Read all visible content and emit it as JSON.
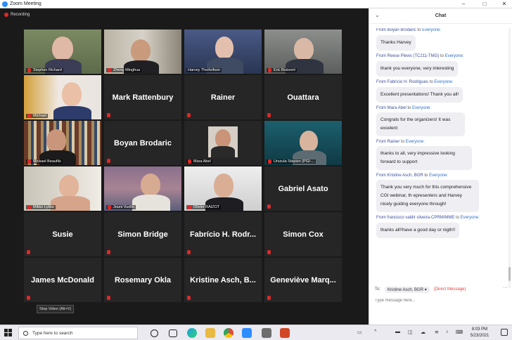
{
  "window": {
    "title": "Zoom Meeting",
    "minimize_glyph": "–",
    "maximize_glyph": "□",
    "close_glyph": "✕"
  },
  "meeting": {
    "recording_label": "Recording",
    "tooltip": "Stop Video (Alt+V)"
  },
  "participants": [
    {
      "name": "Stephen Richard",
      "video": true
    },
    {
      "name": "Zheng Minghua",
      "video": true
    },
    {
      "name": "Harvey Thorleifson",
      "video": true,
      "active": true
    },
    {
      "name": "Eric Boisvert",
      "video": true
    },
    {
      "name": "Michael",
      "video": true
    },
    {
      "name": "Mark Rattenbury",
      "video": false
    },
    {
      "name": "Rainer",
      "video": false
    },
    {
      "name": "Ouattara",
      "video": false
    },
    {
      "name": "Mickael Beaufils",
      "video": true
    },
    {
      "name": "Boyan Brodaric",
      "video": false
    },
    {
      "name": "Mara Abel",
      "video": true
    },
    {
      "name": "Urszula Stepien (PGI-...",
      "video": true
    },
    {
      "name": "Mikko Lykke",
      "video": true
    },
    {
      "name": "Jouni Vuollo",
      "video": true
    },
    {
      "name": "Olivier RAIZOT",
      "video": true
    },
    {
      "name": "Gabriel Asato",
      "video": false
    },
    {
      "name": "Susie",
      "video": false
    },
    {
      "name": "Simon Bridge",
      "video": false
    },
    {
      "name": "Fabrício H. Rodr...",
      "video": false
    },
    {
      "name": "Simon Cox",
      "video": false
    },
    {
      "name": "James McDonald",
      "video": false
    },
    {
      "name": "Rosemary Okla",
      "video": false
    },
    {
      "name": "Kristine Asch, B...",
      "video": false
    },
    {
      "name": "Geneviève Marq...",
      "video": false
    }
  ],
  "chat": {
    "title": "Chat",
    "messages": [
      {
        "from": "Boyan Brodaric",
        "to_word": "to",
        "to": "Everyone:",
        "text": "Thanks Harvey"
      },
      {
        "from": "Reese Plews (TC211-TMG)",
        "to_word": "to",
        "to": "Everyone:",
        "text": "thank you everyone, very interesting"
      },
      {
        "from": "Fabrício H. Rodrigues",
        "to_word": "to",
        "to": "Everyone:",
        "text": "Excellent presentations! Thank you all!"
      },
      {
        "from": "Mara Abel",
        "to_word": "to",
        "to": "Everyone:",
        "text": "Congrats for the organizers! It was excelent"
      },
      {
        "from": "Rainer",
        "to_word": "to",
        "to": "Everyone:",
        "text": "thanks to all, very impressive looking forward to support"
      },
      {
        "from": "Kristine Asch, BGR",
        "to_word": "to",
        "to": "Everyone:",
        "text": "Thank you very much for this comprehensive CGI webinar, th epresenters and Harvey nicely guiding everyone through!"
      },
      {
        "from": "francisco valdir silveira-CPRM/MME",
        "to_word": "to",
        "to": "Everyone:",
        "text": "thanks all!!have a good day or nigth!!"
      }
    ],
    "to_label": "To:",
    "recipient": "Kristine Asch, BGR ▾",
    "direct_message": "(Direct Message)",
    "more_glyph": "···",
    "input_placeholder": "Type message here..."
  },
  "taskbar": {
    "search_placeholder": "Type here to search",
    "time": "8:03 PM",
    "date": "5/23/2021"
  }
}
